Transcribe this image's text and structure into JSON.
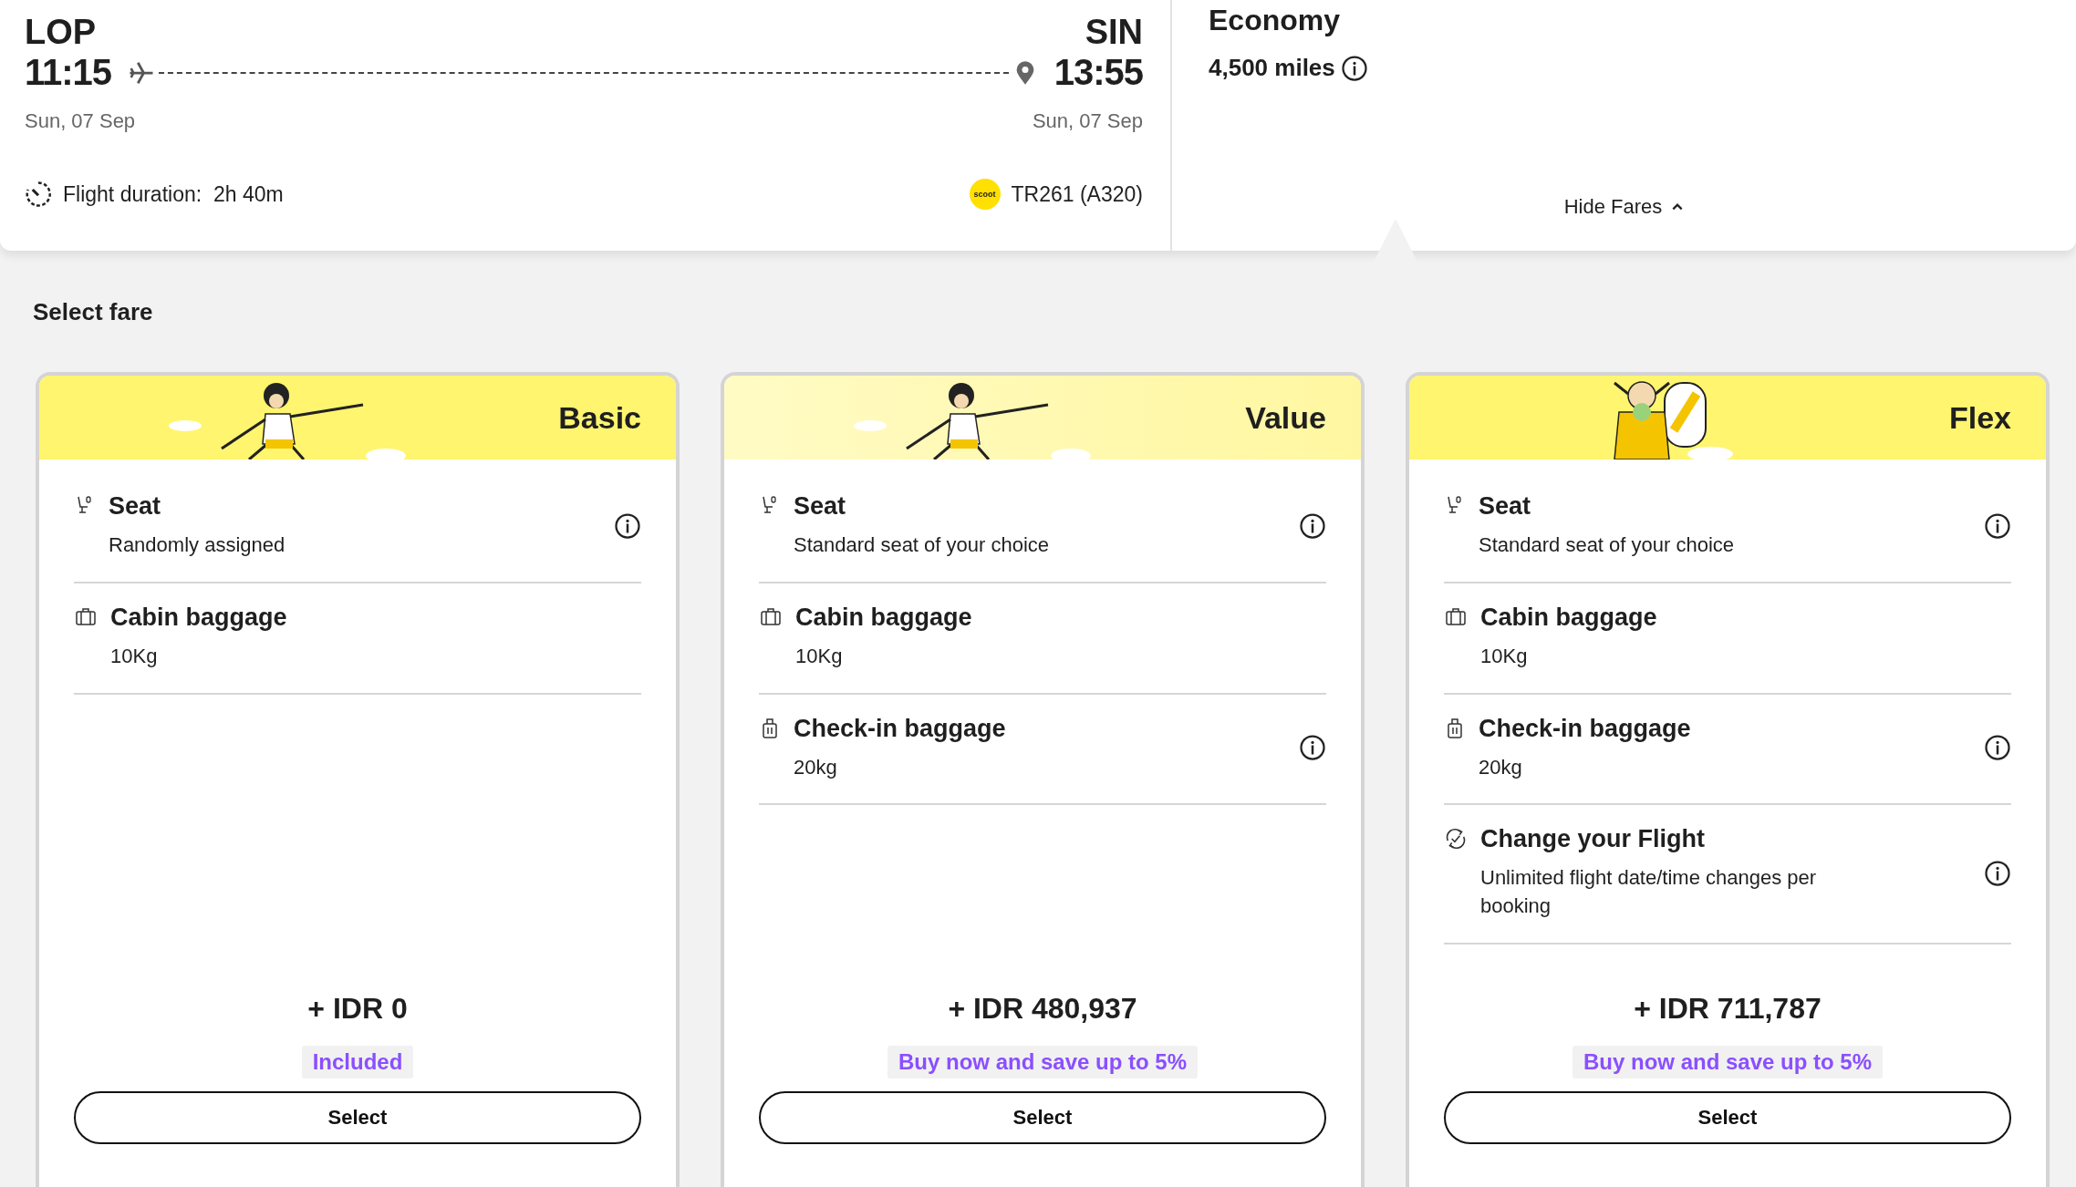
{
  "flight": {
    "origin": "LOP",
    "destination": "SIN",
    "departure_time": "11:15",
    "arrival_time": "13:55",
    "departure_date": "Sun, 07 Sep",
    "arrival_date": "Sun, 07 Sep",
    "duration_label": "Flight duration:",
    "duration": "2h 40m",
    "airline_logo": "scoot",
    "flight_number": "TR261 (A320)"
  },
  "cabin": {
    "name": "Economy",
    "miles": "4,500 miles",
    "toggle": "Hide Fares",
    "expanded": true
  },
  "section_title": "Select fare",
  "fares": [
    {
      "name": "Basic",
      "kind": "dancer",
      "features": [
        {
          "kind": "seat",
          "title": "Seat",
          "detail": "Randomly assigned",
          "info": true
        },
        {
          "kind": "cabin",
          "title": "Cabin baggage",
          "detail": "10Kg",
          "info": false
        }
      ],
      "price": "+ IDR 0",
      "note": "Included",
      "button": "Select"
    },
    {
      "name": "Value",
      "kind": "dancer",
      "features": [
        {
          "kind": "seat",
          "title": "Seat",
          "detail": "Standard seat of your choice",
          "info": true
        },
        {
          "kind": "cabin",
          "title": "Cabin baggage",
          "detail": "10Kg",
          "info": false
        },
        {
          "kind": "checkin",
          "title": "Check-in baggage",
          "detail": "20kg",
          "info": true
        }
      ],
      "price": "+ IDR 480,937",
      "note": "Buy now and save up to 5%",
      "button": "Select"
    },
    {
      "name": "Flex",
      "kind": "traveller",
      "features": [
        {
          "kind": "seat",
          "title": "Seat",
          "detail": "Standard seat of your choice",
          "info": true
        },
        {
          "kind": "cabin",
          "title": "Cabin baggage",
          "detail": "10Kg",
          "info": false
        },
        {
          "kind": "checkin",
          "title": "Check-in baggage",
          "detail": "20kg",
          "info": true
        },
        {
          "kind": "change",
          "title": "Change your Flight",
          "detail": "Unlimited flight date/time changes per booking",
          "info": true
        }
      ],
      "price": "+ IDR 711,787",
      "note": "Buy now and save up to 5%",
      "button": "Select"
    }
  ]
}
